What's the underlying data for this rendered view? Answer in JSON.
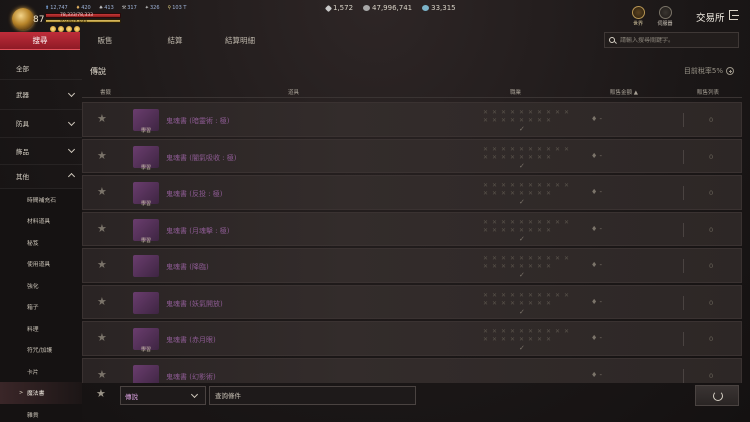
{
  "hud": {
    "level": "87",
    "stats": [
      "12,747",
      "420",
      "413",
      "317",
      "326",
      "103 T"
    ],
    "hp_text": "78,333/78,333",
    "mp_text": "9,034/9,034",
    "hp_fill": 1.0,
    "mp_fill": 1.0,
    "currency": [
      {
        "value": "1,572",
        "color": "#c9c9c9"
      },
      {
        "value": "47,996,741",
        "color": "#a8a8a8"
      },
      {
        "value": "33,315",
        "color": "#7bb3c9"
      }
    ],
    "world_label": "世界",
    "server_label": "伺服器",
    "title": "交易所"
  },
  "tabs": [
    {
      "label": "搜尋",
      "active": true
    },
    {
      "label": "販售",
      "active": false
    },
    {
      "label": "結算",
      "active": false
    },
    {
      "label": "結算明細",
      "active": false
    }
  ],
  "search": {
    "placeholder": "請輸入搜尋關鍵字。"
  },
  "sidebar": {
    "items": [
      {
        "label": "全部"
      },
      {
        "label": "武器"
      },
      {
        "label": "防具"
      },
      {
        "label": "飾品"
      },
      {
        "label": "其他"
      }
    ],
    "sub_items": [
      {
        "label": "時間補充石"
      },
      {
        "label": "材料道具"
      },
      {
        "label": "秘笈"
      },
      {
        "label": "使用道具"
      },
      {
        "label": "強化"
      },
      {
        "label": "箱子"
      },
      {
        "label": "料理"
      },
      {
        "label": "符咒/加護"
      },
      {
        "label": "卡片"
      },
      {
        "label": "魔法書"
      },
      {
        "label": "雜貨"
      }
    ],
    "active_arrow": ">"
  },
  "main": {
    "section_title": "傳說",
    "tax_rate": "目前稅率5%",
    "columns": {
      "fav": "書籤",
      "item": "道具",
      "class": "職業",
      "price": "販售金額 ▲",
      "listings": "販售列表"
    },
    "book_label": "學習",
    "rows": [
      {
        "name": "鬼魂書 (暗靈術 : 極)",
        "price": "-",
        "count": "0"
      },
      {
        "name": "鬼魂書 (闇氣吸收 : 極)",
        "price": "-",
        "count": "0"
      },
      {
        "name": "鬼魂書 (反投 : 極)",
        "price": "-",
        "count": "0"
      },
      {
        "name": "鬼魂書 (月魂擊 : 極)",
        "price": "-",
        "count": "0"
      },
      {
        "name": "鬼魂書 (降臨)",
        "price": "-",
        "count": "0"
      },
      {
        "name": "鬼魂書 (妖氣開放)",
        "price": "-",
        "count": "0"
      },
      {
        "name": "鬼魂書 (赤月眼)",
        "price": "-",
        "count": "0"
      },
      {
        "name": "鬼魂書 (幻影術)",
        "price": "-",
        "count": "0"
      }
    ]
  },
  "bottom": {
    "grade": "傳說",
    "query_placeholder": "查詢條件"
  }
}
